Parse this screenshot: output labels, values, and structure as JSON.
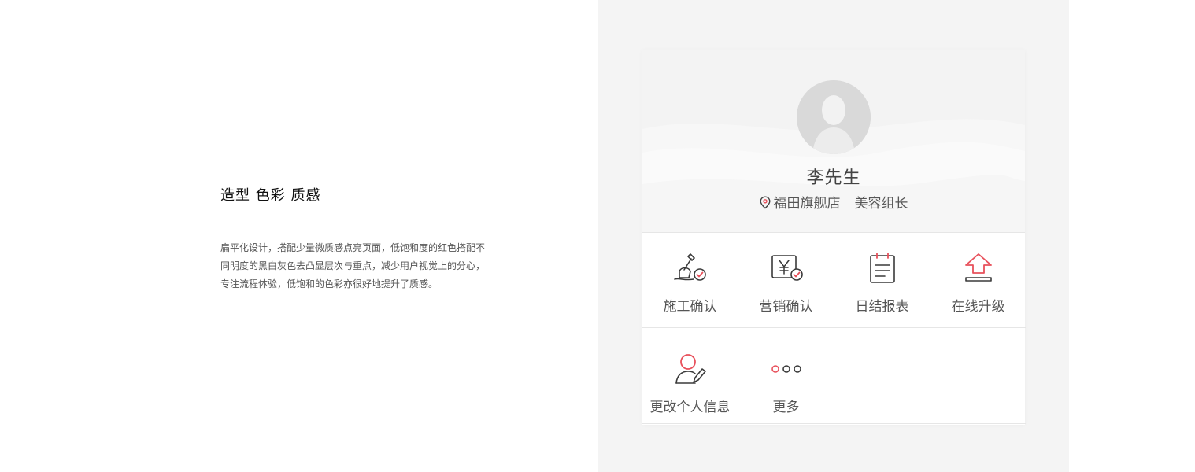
{
  "intro": {
    "title": "造型 色彩 质感",
    "body_lines": [
      "扁平化设计，搭配少量微质感点亮页面，低饱和度的红色搭配不",
      "同明度的黑白灰色去凸显层次与重点，减少用户视觉上的分心，",
      "专注流程体验，低饱和的色彩亦很好地提升了质感。"
    ]
  },
  "profile": {
    "name": "李先生",
    "store": "福田旗舰店",
    "role": "美容组长",
    "avatar_icon": "user-avatar-placeholder",
    "location_icon": "location-pin-icon"
  },
  "menu": [
    {
      "label": "施工确认",
      "icon": "shovel-check-icon"
    },
    {
      "label": "营销确认",
      "icon": "yuen-check-icon"
    },
    {
      "label": "日结报表",
      "icon": "notepad-icon"
    },
    {
      "label": "在线升级",
      "icon": "upload-arrow-icon"
    },
    {
      "label": "更改个人信息",
      "icon": "user-edit-icon"
    },
    {
      "label": "更多",
      "icon": "more-dots-icon"
    }
  ],
  "colors": {
    "accent": "#e8505b",
    "panel_bg": "#f4f4f4",
    "icon_stroke": "#3a3a3a"
  }
}
